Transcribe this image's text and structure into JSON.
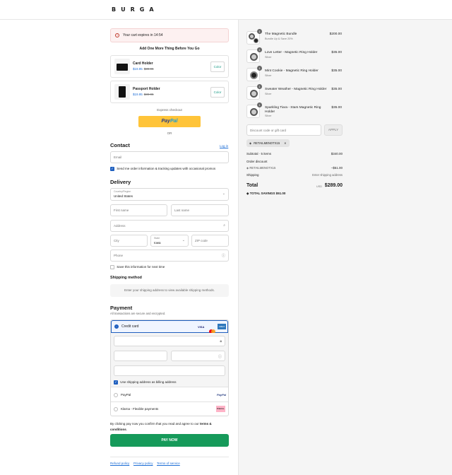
{
  "brand": {
    "logo": "BURGA"
  },
  "timer": {
    "text": "Your cart expires in 14:54"
  },
  "upsell": {
    "title": "Add One More Thing Before You Go",
    "items": [
      {
        "name": "Card Holder",
        "price": "$19.95",
        "compare": "$39.95",
        "button": "Color"
      },
      {
        "name": "Passport Holder",
        "price": "$19.95",
        "compare": "$39.95",
        "button": "Color"
      }
    ]
  },
  "express": {
    "label": "Express checkout",
    "paypal_pay": "Pay",
    "paypal_pal": "Pal",
    "or": "OR"
  },
  "contact": {
    "title": "Contact",
    "login": "Log in",
    "email_placeholder": "Email",
    "newsletter": "Send me order information & tracking updates with occasional promos"
  },
  "delivery": {
    "title": "Delivery",
    "country_label": "Country/Region",
    "country_value": "United States",
    "first_name": "First name",
    "last_name": "Last name",
    "address": "Address",
    "city": "City",
    "state_label": "State",
    "state_value": "Iowa",
    "zip": "ZIP code",
    "phone": "Phone",
    "save_info": "Save this information for next time"
  },
  "shipping": {
    "title": "Shipping method",
    "message": "Enter your shipping address to view available shipping methods."
  },
  "payment": {
    "title": "Payment",
    "subtitle": "All transactions are secure and encrypted.",
    "credit_card": "Credit card",
    "card_brands": [
      "VISA",
      "AMEX"
    ],
    "billing_same": "Use shipping address as billing address",
    "paypal": "PayPal",
    "klarna": "Klarna - Flexible payments",
    "klarna_logo": "Klarna."
  },
  "agree": {
    "text": "By clicking pay now you confirm that you read and agree to our",
    "link": "terms & conditions",
    "end": "."
  },
  "paynow": {
    "label": "PAY NOW"
  },
  "footer": {
    "refund": "Refund policy",
    "privacy": "Privacy policy",
    "terms": "Terms of service"
  },
  "order": {
    "items": [
      {
        "qty": "1",
        "name": "The Magnetic Bundle",
        "variant": "Bundle Up & Save 20%",
        "price": "$200.00"
      },
      {
        "qty": "1",
        "name": "Love Letter - Magnetic Ring Holder",
        "variant": "Silver",
        "price": "$35.00"
      },
      {
        "qty": "1",
        "name": "Mint Cookie - Magnetic Ring Holder",
        "variant": "Silver",
        "price": "$35.00"
      },
      {
        "qty": "1",
        "name": "Sweater Weather - Magnetic Ring Holder",
        "variant": "Silver",
        "price": "$35.00"
      },
      {
        "qty": "1",
        "name": "Sparkling Tiara - Stars Magnetic Ring Holder",
        "variant": "Silver",
        "price": "$35.00"
      }
    ],
    "discount_placeholder": "Discount code or gift card",
    "apply": "APPLY",
    "code_tag": "RETAILMENOTX15",
    "subtotal_label": "Subtotal · 5 items",
    "subtotal_value": "$340.00",
    "order_discount": "Order discount",
    "discount_code": "RETAILMENOTX15",
    "discount_value": "−$51.00",
    "shipping_label": "Shipping",
    "shipping_value": "Enter shipping address",
    "total_label": "Total",
    "currency": "USD",
    "total_value": "$289.00",
    "savings_label": "TOTAL SAVINGS",
    "savings_value": "$51.00"
  },
  "colors": {
    "accent": "#1f5fbf",
    "paynow": "#169a5a",
    "paypal": "#ffc439"
  }
}
